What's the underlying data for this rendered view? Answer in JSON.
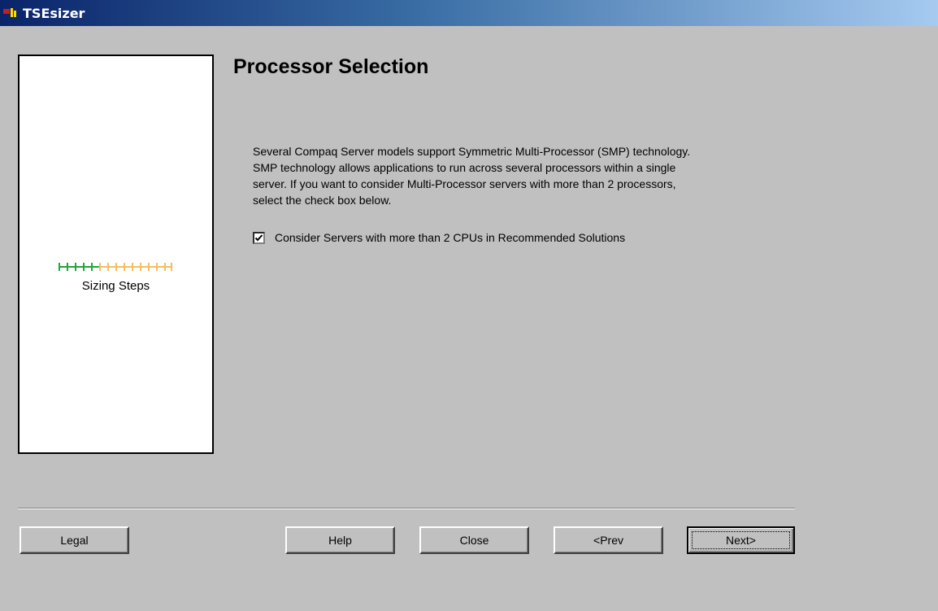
{
  "window": {
    "title": "TSEsizer",
    "icon": "tsesizer-app-icon"
  },
  "progress": {
    "caption": "Sizing Steps",
    "total_steps": 14,
    "completed_steps": 5,
    "completed_color": "#1fa83a",
    "remaining_color": "#f0c060"
  },
  "main": {
    "title": "Processor Selection",
    "description": [
      "Several Compaq Server models support Symmetric Multi-Processor (SMP) technology.",
      "SMP technology allows applications to run across several processors within a single",
      "server. If you want to consider Multi-Processor servers with more than 2 processors,",
      "select the check box below."
    ],
    "checkbox": {
      "label": "Consider Servers with more than 2 CPUs in Recommended Solutions",
      "checked": true
    }
  },
  "buttons": {
    "legal": "Legal",
    "help": "Help",
    "close": "Close",
    "prev": "<Prev",
    "next": "Next>"
  }
}
